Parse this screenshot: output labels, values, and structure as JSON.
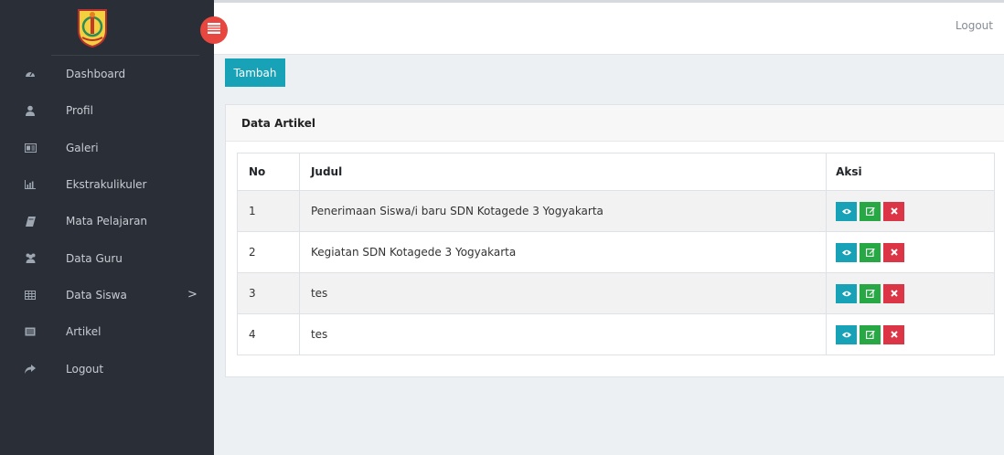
{
  "sidebar": {
    "items": [
      {
        "label": "Dashboard",
        "icon": "dashboard-icon"
      },
      {
        "label": "Profil",
        "icon": "user-icon"
      },
      {
        "label": "Galeri",
        "icon": "gallery-icon"
      },
      {
        "label": "Ekstrakulikuler",
        "icon": "bar-chart-icon"
      },
      {
        "label": "Mata Pelajaran",
        "icon": "book-icon"
      },
      {
        "label": "Data Guru",
        "icon": "users-icon"
      },
      {
        "label": "Data Siswa",
        "icon": "table-icon",
        "caret": ">"
      },
      {
        "label": "Artikel",
        "icon": "newspaper-icon"
      },
      {
        "label": "Logout",
        "icon": "share-icon"
      }
    ]
  },
  "topbar": {
    "logout": "Logout"
  },
  "main": {
    "add_button": "Tambah"
  },
  "card": {
    "title": "Data Artikel",
    "columns": [
      "No",
      "Judul",
      "Aksi"
    ],
    "rows": [
      {
        "no": "1",
        "judul": "Penerimaan Siswa/i baru SDN Kotagede 3 Yogyakarta"
      },
      {
        "no": "2",
        "judul": "Kegiatan SDN Kotagede 3 Yogyakarta"
      },
      {
        "no": "3",
        "judul": "tes"
      },
      {
        "no": "4",
        "judul": "tes"
      }
    ]
  },
  "colors": {
    "sidebar": "#2a2e36",
    "toggle": "#e8473f",
    "info": "#17a2b8",
    "success": "#28a745",
    "danger": "#dc3545"
  }
}
